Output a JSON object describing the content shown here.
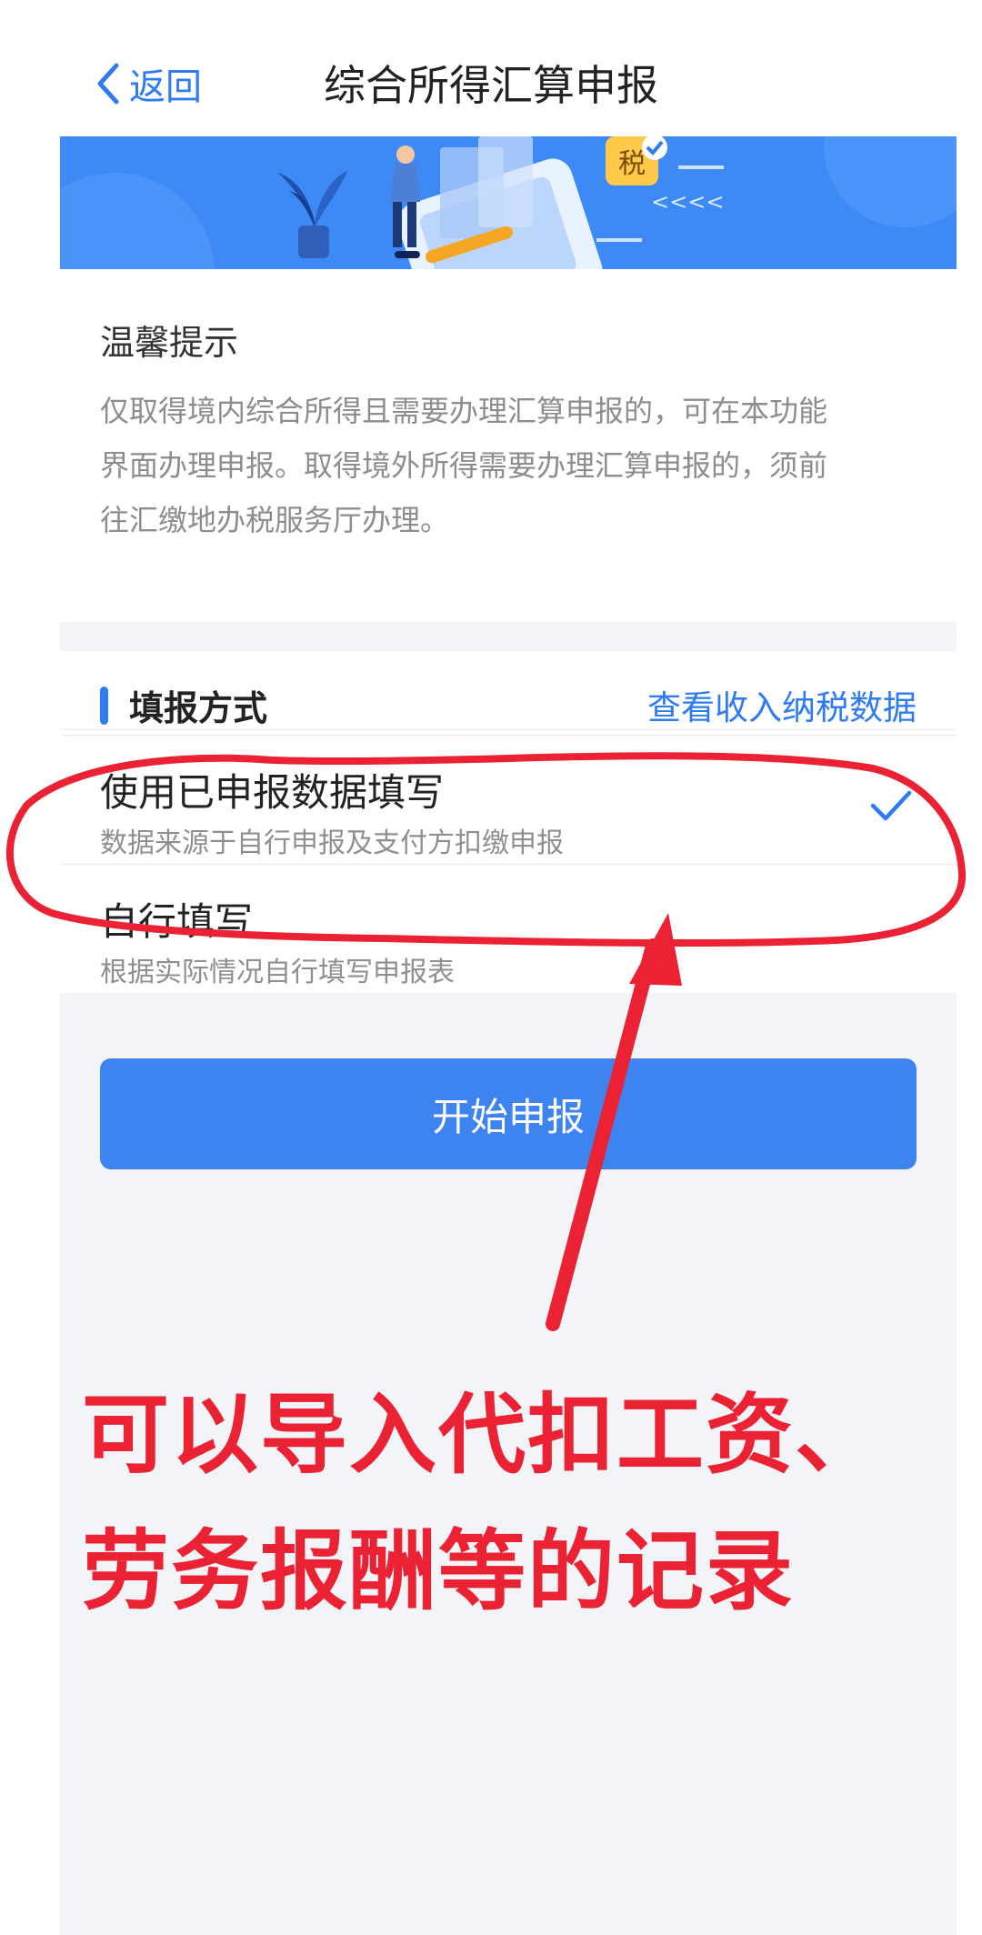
{
  "header": {
    "back_label": "返回",
    "title": "综合所得汇算申报"
  },
  "banner": {
    "tax_badge": "税",
    "arrows": "<<<<"
  },
  "notice": {
    "title": "温馨提示",
    "lines": [
      "仅取得境内综合所得且需要办理汇算申报的，可在本功能",
      "界面办理申报。取得境外所得需要办理汇算申报的，须前",
      "往汇缴地办税服务厅办理。"
    ]
  },
  "fill_method": {
    "section_title": "填报方式",
    "view_link": "查看收入纳税数据",
    "options": [
      {
        "title": "使用已申报数据填写",
        "subtitle": "数据来源于自行申报及支付方扣缴申报",
        "selected": true
      },
      {
        "title": "自行填写",
        "subtitle": "根据实际情况自行填写申报表",
        "selected": false
      }
    ]
  },
  "actions": {
    "start_button": "开始申报"
  },
  "annotation": {
    "line1": "可以导入代扣工资、",
    "line2": "劳务报酬等的记录",
    "color": "#ea2233"
  },
  "colors": {
    "accent": "#2f7bf0",
    "banner": "#3d8af7",
    "page_gray": "#f2f4f8"
  }
}
